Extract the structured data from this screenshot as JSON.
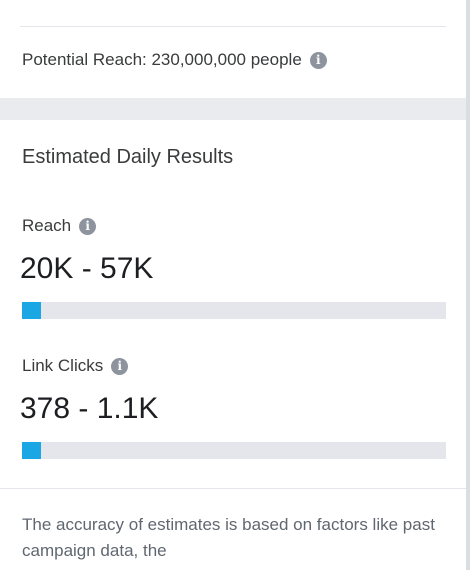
{
  "potential_reach": {
    "text": "Potential Reach: 230,000,000 people",
    "info_icon": "info-icon"
  },
  "estimated_daily_results": {
    "title": "Estimated Daily Results",
    "metrics": [
      {
        "label": "Reach",
        "value": "20K - 57K",
        "bar_fraction": 0.045
      },
      {
        "label": "Link Clicks",
        "value": "378 - 1.1K",
        "bar_fraction": 0.045
      }
    ]
  },
  "disclaimer": "The accuracy of estimates is based on factors like past campaign data, the",
  "colors": {
    "bar_fill": "#1aa7e4",
    "bar_track": "#e4e6eb",
    "info_icon": "#8d949e"
  }
}
